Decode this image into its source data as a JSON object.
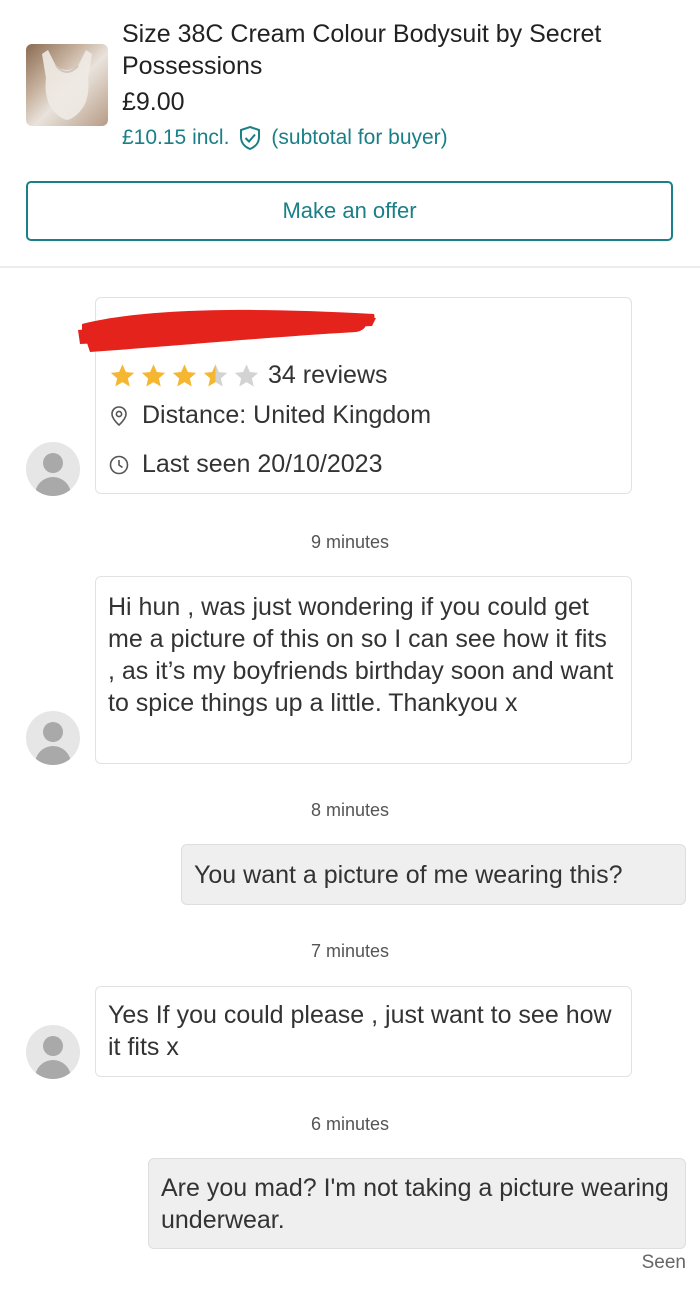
{
  "item": {
    "title": "Size 38C Cream Colour Bodysuit by Secret Possessions",
    "price": "£9.00",
    "incl_price": "£10.15 incl.",
    "subtotal_note": "(subtotal for buyer)",
    "make_offer_label": "Make an offer",
    "accent_color": "#1a7f86"
  },
  "profile": {
    "rating_stars": 3.5,
    "rating_max": 5,
    "reviews": "34 reviews",
    "distance": "Distance: United Kingdom",
    "last_seen": "Last seen 20/10/2023",
    "username_redacted": true
  },
  "messages": [
    {
      "time": "9 minutes",
      "from": "other",
      "text": "Hi hun , was just wondering if you could get me a picture of this on so I can see how it fits , as it’s my boyfriends birthday soon and want to spice things up a little. Thankyou x"
    },
    {
      "time": "8 minutes",
      "from": "me",
      "text": "You want a picture of me wearing this?"
    },
    {
      "time": "7 minutes",
      "from": "other",
      "text": "Yes If you could please , just want to see how it fits x"
    },
    {
      "time": "6 minutes",
      "from": "me",
      "text": "Are you mad? I'm not taking a picture wearing underwear."
    }
  ],
  "status": {
    "seen": "Seen"
  }
}
